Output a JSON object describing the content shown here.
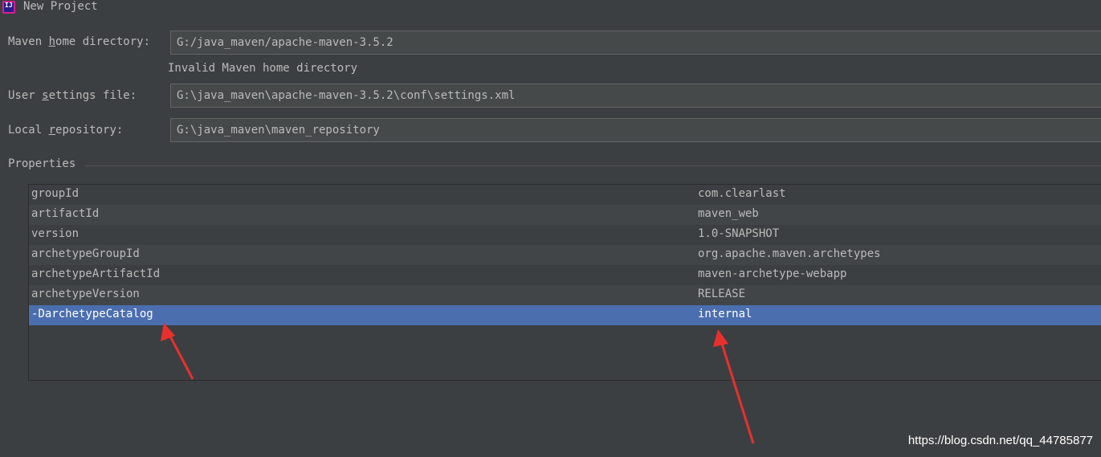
{
  "window": {
    "icon": "intellij-idea-icon",
    "title": "New Project"
  },
  "fields": {
    "maven_home": {
      "label_pre": "Maven ",
      "label_mnemonic": "h",
      "label_post": "ome directory:",
      "value": "G:/java_maven/apache-maven-3.5.2",
      "error": "Invalid Maven home directory"
    },
    "user_settings": {
      "label_pre": "User ",
      "label_mnemonic": "s",
      "label_post": "ettings file:",
      "value": "G:\\java_maven\\apache-maven-3.5.2\\conf\\settings.xml"
    },
    "local_repository": {
      "label_pre": "Local ",
      "label_mnemonic": "r",
      "label_post": "epository:",
      "value": "G:\\java_maven\\maven_repository"
    }
  },
  "properties": {
    "header": "Properties",
    "rows": [
      {
        "key": "groupId",
        "value": "com.clearlast"
      },
      {
        "key": "artifactId",
        "value": "maven_web"
      },
      {
        "key": "version",
        "value": "1.0-SNAPSHOT"
      },
      {
        "key": "archetypeGroupId",
        "value": "org.apache.maven.archetypes"
      },
      {
        "key": "archetypeArtifactId",
        "value": "maven-archetype-webapp"
      },
      {
        "key": "archetypeVersion",
        "value": "RELEASE"
      },
      {
        "key": "-DarchetypeCatalog",
        "value": "internal"
      }
    ],
    "selected_index": 6
  },
  "annotations": {
    "arrow_color": "#e8302f"
  },
  "watermark": "https://blog.csdn.net/qq_44785877",
  "colors": {
    "background": "#3c3f41",
    "selection": "#4b6eaf",
    "field_bg": "#45494a"
  }
}
